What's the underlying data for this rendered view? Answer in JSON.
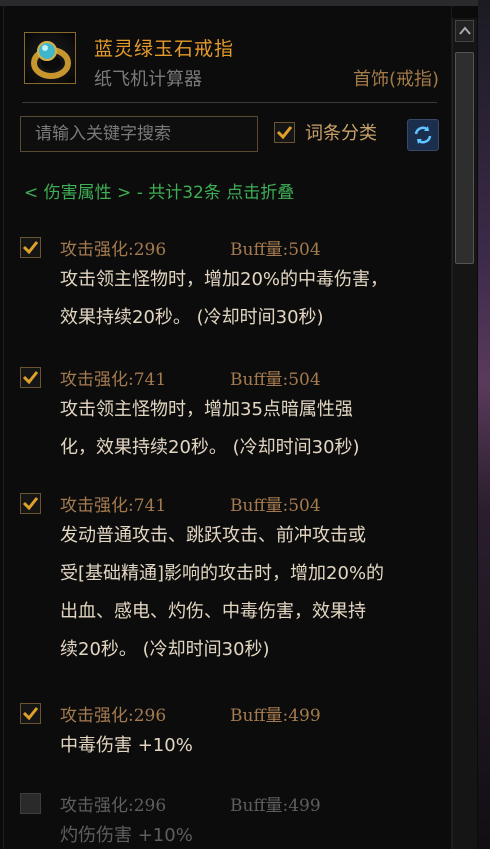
{
  "item": {
    "name": "蓝灵绿玉石戒指",
    "source": "纸飞机计算器",
    "category": "首饰(戒指)",
    "icon": "ring-icon"
  },
  "search": {
    "placeholder": "请输入关键字搜索",
    "value": ""
  },
  "classify": {
    "label": "词条分类",
    "checked": true
  },
  "refresh": {
    "icon": "refresh-icon"
  },
  "group": {
    "toggle_text": "< 伤害属性 > - 共计32条 点击折叠"
  },
  "entries": [
    {
      "checked": true,
      "stat": "攻击强化:296",
      "buff": "Buff量:504",
      "desc_lines": [
        "攻击领主怪物时，增加20%的中毒伤害，",
        "效果持续20秒。 (冷却时间30秒)"
      ]
    },
    {
      "checked": true,
      "stat": "攻击强化:741",
      "buff": "Buff量:504",
      "desc_lines": [
        "攻击领主怪物时，增加35点暗属性强",
        "化，效果持续20秒。 (冷却时间30秒)"
      ]
    },
    {
      "checked": true,
      "stat": "攻击强化:741",
      "buff": "Buff量:504",
      "desc_lines": [
        "发动普通攻击、跳跃攻击、前冲攻击或",
        "受[基础精通]影响的攻击时，增加20%的",
        "出血、感电、灼伤、中毒伤害，效果持",
        "续20秒。 (冷却时间30秒)"
      ]
    },
    {
      "checked": true,
      "stat": "攻击强化:296",
      "buff": "Buff量:499",
      "desc_lines": [
        "中毒伤害 +10%"
      ]
    },
    {
      "checked": false,
      "stat": "攻击强化:296",
      "buff": "Buff量:499",
      "desc_lines": [
        "灼伤伤害 +10%"
      ]
    }
  ],
  "colors": {
    "title": "#e39a2c",
    "group_toggle": "#3fae55",
    "stat": "#a47a4f",
    "desc": "#e2d6c2",
    "check": "#e0a12a"
  }
}
